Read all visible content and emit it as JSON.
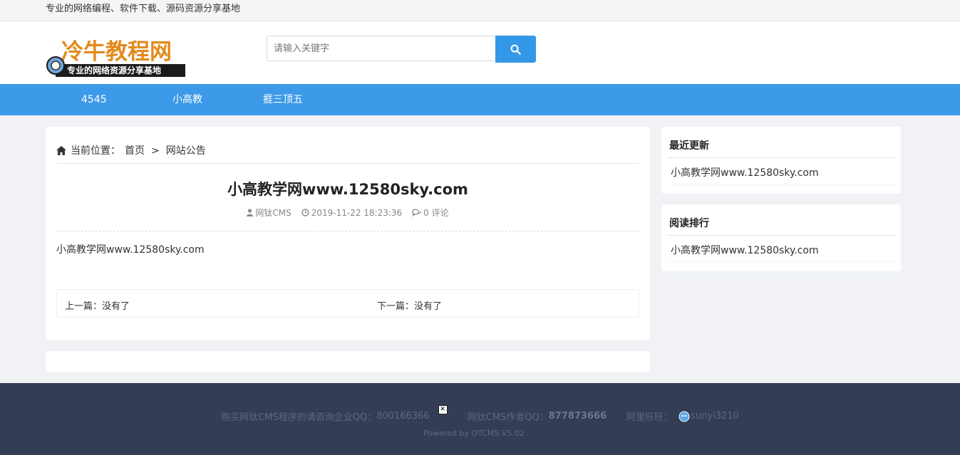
{
  "topbar": {
    "tagline": "专业的网络编程、软件下载、源码资源分享基地"
  },
  "logo": {
    "text": "冷牛教程网",
    "sub": "专业的网络资源分享基地"
  },
  "search": {
    "placeholder": "请输入关键字",
    "icon": "search-icon"
  },
  "nav": {
    "items": [
      "4545",
      "小高教",
      "捱三顶五"
    ]
  },
  "breadcrumb": {
    "icon": "home-icon",
    "prefix": "当前位置：",
    "home": "首页",
    "separator": ">",
    "current": "网站公告"
  },
  "article": {
    "title": "小高教学网www.12580sky.com",
    "author": "网钛CMS",
    "datetime": "2019-11-22 18:23:36",
    "comments": "0 评论",
    "body": "小高教学网www.12580sky.com",
    "prev": "上一篇：没有了",
    "next": "下一篇：没有了"
  },
  "sidebar": {
    "recent": {
      "title": "最近更新",
      "items": [
        "小高教学网www.12580sky.com"
      ]
    },
    "ranking": {
      "title": "阅读排行",
      "items": [
        "小高教学网www.12580sky.com"
      ]
    }
  },
  "footer": {
    "buy_label": "购买网钛CMS程序的请咨询企业QQ：",
    "buy_qq": "800166366",
    "author_label": "网钛CMS作者QQ：",
    "author_qq": "877873666",
    "ww_label": "阿里旺旺：",
    "ww_id": "sunyi3210",
    "powered": "Powered by OTCMS V5.02"
  },
  "colors": {
    "accent": "#3d9ae8",
    "search_button": "#3498e8",
    "footer_bg": "#333d54",
    "page_bg": "#f0f2f5"
  }
}
